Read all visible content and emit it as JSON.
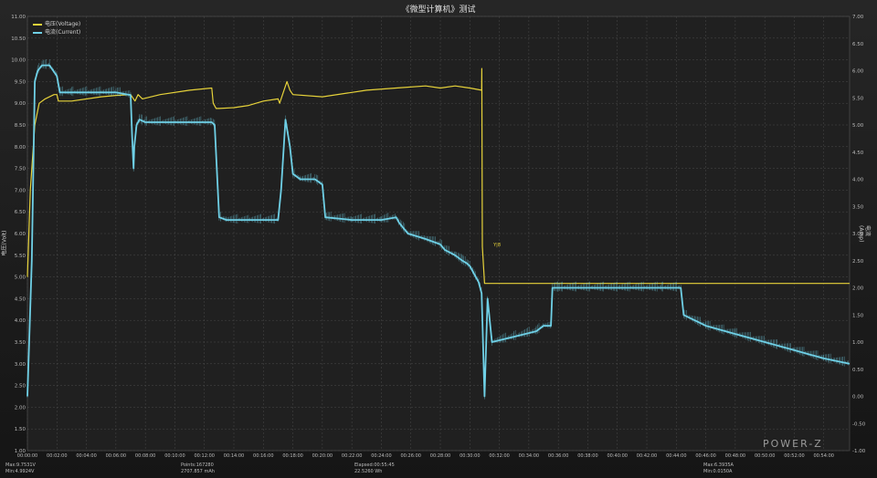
{
  "title": "《微型计算机》测试",
  "legend": [
    {
      "label": "电压(Voltage)",
      "color": "#e6d23a"
    },
    {
      "label": "电流(Current)",
      "color": "#6fd0e6"
    }
  ],
  "ylabel_left": "电压(Volt)",
  "ylabel_right": "电流(Amp)",
  "logo": "POWER-Z",
  "stats": {
    "max_v": "Max:9.7531V",
    "min_v": "Min:4.9924V",
    "points": "Points:167280",
    "capacity": "2707.857 mAh",
    "elapsed": "Elapsed:00:55:45",
    "energy": "22.5260 Wh",
    "max_a": "Max:6.3935A",
    "min_a": "Min:0.0150A"
  },
  "chart_data": {
    "type": "line",
    "title": "《微型计算机》测试",
    "xlabel": "",
    "x_ticks": [
      "00:00:00",
      "00:02:00",
      "00:04:00",
      "00:06:00",
      "00:08:00",
      "00:10:00",
      "00:12:00",
      "00:14:00",
      "00:16:00",
      "00:18:00",
      "00:20:00",
      "00:22:00",
      "00:24:00",
      "00:26:00",
      "00:28:00",
      "00:30:00",
      "00:32:00",
      "00:34:00",
      "00:36:00",
      "00:38:00",
      "00:40:00",
      "00:42:00",
      "00:44:00",
      "00:46:00",
      "00:48:00",
      "00:50:00",
      "00:52:00",
      "00:54:00"
    ],
    "xlim_minutes": [
      0,
      55.75
    ],
    "y_left": {
      "label": "电压(Volt)",
      "lim": [
        1.0,
        11.0
      ],
      "ticks": [
        "1.00",
        "1.50",
        "2.00",
        "2.50",
        "3.00",
        "3.50",
        "4.00",
        "4.50",
        "5.00",
        "5.50",
        "6.00",
        "6.50",
        "7.00",
        "7.50",
        "8.00",
        "8.50",
        "9.00",
        "9.50",
        "10.00",
        "10.50",
        "11.00"
      ]
    },
    "y_right": {
      "label": "电流(Amp)",
      "lim": [
        -1.0,
        7.0
      ],
      "ticks": [
        "-1.00",
        "-0.50",
        "0.00",
        "0.50",
        "1.00",
        "1.50",
        "2.00",
        "2.50",
        "3.00",
        "3.50",
        "4.00",
        "4.50",
        "5.00",
        "5.50",
        "6.00",
        "6.50",
        "7.00"
      ]
    },
    "grid": true,
    "legend_position": "top-left",
    "series": [
      {
        "name": "电压(Voltage)",
        "axis": "left",
        "x_minutes": [
          0,
          0.2,
          0.5,
          0.8,
          1.2,
          1.8,
          2.0,
          2.1,
          3,
          5,
          6,
          7,
          7.3,
          7.5,
          7.8,
          9,
          11,
          12.5,
          12.6,
          12.8,
          13,
          14,
          15,
          16,
          17,
          17.1,
          17.3,
          17.6,
          17.8,
          18,
          20,
          22,
          23,
          25,
          27,
          28,
          29,
          30,
          30.8,
          30.81,
          30.85,
          31,
          55.75
        ],
        "values": [
          5.0,
          7.0,
          8.5,
          9.0,
          9.1,
          9.2,
          9.2,
          9.05,
          9.05,
          9.15,
          9.18,
          9.2,
          9.05,
          9.2,
          9.1,
          9.2,
          9.3,
          9.35,
          9.0,
          8.88,
          8.88,
          8.9,
          8.95,
          9.05,
          9.1,
          9.0,
          9.2,
          9.5,
          9.3,
          9.2,
          9.15,
          9.25,
          9.3,
          9.35,
          9.4,
          9.35,
          9.4,
          9.35,
          9.3,
          9.8,
          5.7,
          4.85,
          4.85
        ]
      },
      {
        "name": "电流(Current)",
        "axis": "right",
        "x_minutes": [
          0,
          0.3,
          0.5,
          0.7,
          1.0,
          1.5,
          2.0,
          2.2,
          3,
          5,
          6,
          7,
          7.1,
          7.2,
          7.25,
          7.4,
          7.6,
          8,
          10,
          12.5,
          12.7,
          13,
          13.5,
          15,
          17,
          17.2,
          17.5,
          17.8,
          18,
          18.5,
          19.5,
          20,
          20.2,
          22,
          24,
          25,
          25.2,
          25.8,
          27,
          28,
          28.3,
          29,
          29.5,
          29.8,
          30,
          30.2,
          30.4,
          30.6,
          30.8,
          31.0,
          31.2,
          31.5,
          33,
          34.5,
          35,
          35.5,
          35.6,
          36,
          40,
          43,
          44.3,
          44.5,
          46,
          48,
          50,
          52,
          54,
          55.75
        ],
        "values": [
          0,
          2.5,
          5.8,
          6.0,
          6.1,
          6.1,
          5.9,
          5.6,
          5.6,
          5.6,
          5.6,
          5.55,
          4.8,
          4.2,
          4.6,
          5.0,
          5.1,
          5.05,
          5.05,
          5.05,
          5.0,
          3.3,
          3.25,
          3.25,
          3.25,
          3.8,
          5.1,
          4.6,
          4.1,
          4.0,
          4.0,
          3.9,
          3.3,
          3.25,
          3.25,
          3.3,
          3.2,
          3.0,
          2.9,
          2.8,
          2.7,
          2.6,
          2.5,
          2.45,
          2.4,
          2.3,
          2.2,
          2.1,
          1.9,
          0.0,
          1.8,
          1.0,
          1.1,
          1.2,
          1.3,
          1.3,
          2.0,
          2.0,
          2.0,
          2.0,
          2.0,
          1.5,
          1.3,
          1.15,
          1.0,
          0.85,
          0.7,
          0.6
        ]
      }
    ],
    "annotation": {
      "text": "Y|8",
      "minute": 31.6,
      "value_right": 2.8
    }
  }
}
